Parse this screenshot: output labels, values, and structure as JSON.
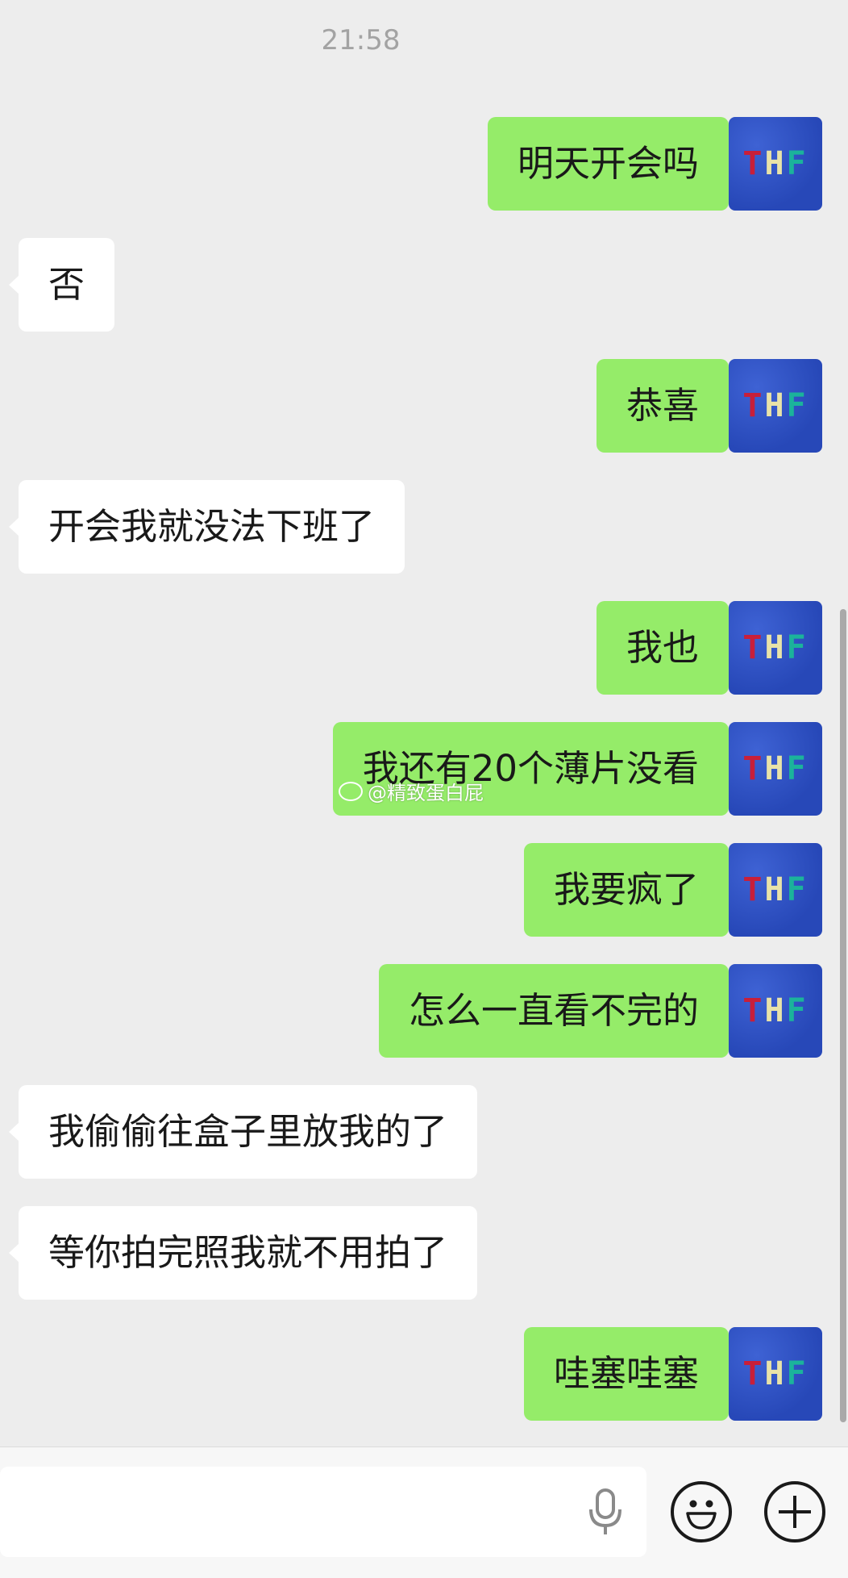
{
  "chat": {
    "timestamp": "21:58",
    "messages": [
      {
        "direction": "out",
        "text": "明天开会吗"
      },
      {
        "direction": "in",
        "text": "否"
      },
      {
        "direction": "out",
        "text": "恭喜"
      },
      {
        "direction": "in",
        "text": "开会我就没法下班了"
      },
      {
        "direction": "out",
        "text": "我也"
      },
      {
        "direction": "out",
        "text": "我还有20个薄片没看"
      },
      {
        "direction": "out",
        "text": "我要疯了"
      },
      {
        "direction": "out",
        "text": "怎么一直看不完的"
      },
      {
        "direction": "in",
        "text": "我偷偷往盒子里放我的了"
      },
      {
        "direction": "in",
        "text": "等你拍完照我就不用拍了"
      },
      {
        "direction": "out",
        "text": "哇塞哇塞"
      }
    ],
    "avatar": {
      "letters": [
        "T",
        "H",
        "F"
      ]
    },
    "watermark": "@精致蛋白屁"
  },
  "input_bar": {
    "icons": [
      "microphone-icon",
      "emoji-icon",
      "plus-icon"
    ]
  },
  "colors": {
    "background": "#ededed",
    "outgoing_bubble": "#95ec69",
    "incoming_bubble": "#ffffff",
    "avatar_bg": "#2d4fc0"
  }
}
